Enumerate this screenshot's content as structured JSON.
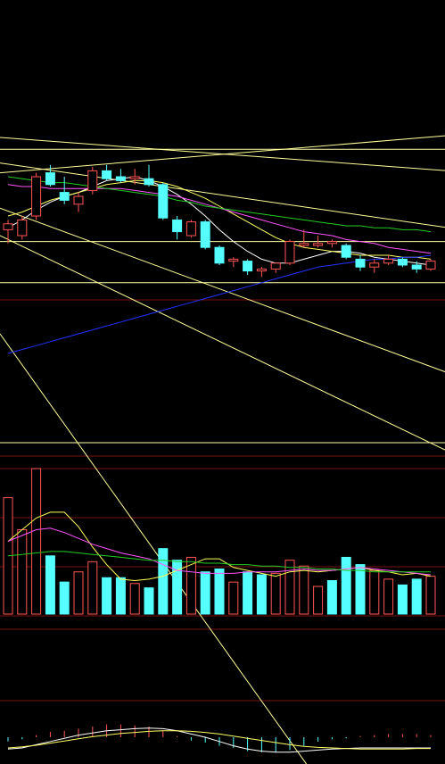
{
  "colors": {
    "background": "#000000",
    "up": "#ff5555",
    "down": "#55ffff",
    "grid": "#7a1010",
    "ma5": "#ffffff",
    "ma10": "#ffff66",
    "ma20": "#ff55ff",
    "ma30": "#22cc22",
    "ma60": "#2233ff",
    "trendline": "#ffff99",
    "hline": "#ffffaa",
    "vol_ma5": "#ffff55",
    "vol_ma10": "#ff55ff",
    "vol_ma20": "#22cc22"
  },
  "chart_data": [
    {
      "type": "candlestick",
      "panel": "price",
      "title": "",
      "ylim": [
        0,
        100
      ],
      "grid": true,
      "candles": [
        {
          "o": 33,
          "h": 38,
          "l": 26,
          "c": 36
        },
        {
          "o": 30,
          "h": 40,
          "l": 28,
          "c": 38
        },
        {
          "o": 40,
          "h": 62,
          "l": 38,
          "c": 60
        },
        {
          "o": 62,
          "h": 66,
          "l": 55,
          "c": 56
        },
        {
          "o": 52,
          "h": 60,
          "l": 46,
          "c": 48
        },
        {
          "o": 46,
          "h": 52,
          "l": 42,
          "c": 50
        },
        {
          "o": 53,
          "h": 65,
          "l": 51,
          "c": 63
        },
        {
          "o": 63,
          "h": 66,
          "l": 58,
          "c": 59
        },
        {
          "o": 60,
          "h": 64,
          "l": 57,
          "c": 58
        },
        {
          "o": 59,
          "h": 64,
          "l": 56,
          "c": 60
        },
        {
          "o": 59,
          "h": 66,
          "l": 55,
          "c": 56
        },
        {
          "o": 56,
          "h": 57,
          "l": 38,
          "c": 39
        },
        {
          "o": 38,
          "h": 40,
          "l": 28,
          "c": 32
        },
        {
          "o": 30,
          "h": 38,
          "l": 29,
          "c": 37
        },
        {
          "o": 37,
          "h": 38,
          "l": 23,
          "c": 24
        },
        {
          "o": 24,
          "h": 25,
          "l": 15,
          "c": 16
        },
        {
          "o": 17,
          "h": 19,
          "l": 14,
          "c": 18
        },
        {
          "o": 17,
          "h": 18,
          "l": 10,
          "c": 12
        },
        {
          "o": 12,
          "h": 14,
          "l": 9,
          "c": 13
        },
        {
          "o": 13,
          "h": 15,
          "l": 11,
          "c": 16
        },
        {
          "o": 16,
          "h": 28,
          "l": 15,
          "c": 27
        },
        {
          "o": 25,
          "h": 33,
          "l": 24,
          "c": 26
        },
        {
          "o": 25,
          "h": 30,
          "l": 24,
          "c": 26
        },
        {
          "o": 26,
          "h": 28,
          "l": 24,
          "c": 27
        },
        {
          "o": 25,
          "h": 26,
          "l": 18,
          "c": 19
        },
        {
          "o": 18,
          "h": 20,
          "l": 12,
          "c": 14
        },
        {
          "o": 14,
          "h": 18,
          "l": 11,
          "c": 16
        },
        {
          "o": 16,
          "h": 20,
          "l": 15,
          "c": 18
        },
        {
          "o": 18,
          "h": 19,
          "l": 14,
          "c": 15
        },
        {
          "o": 15,
          "h": 17,
          "l": 11,
          "c": 13
        },
        {
          "o": 13,
          "h": 18,
          "l": 12,
          "c": 17
        }
      ],
      "moving_averages": [
        {
          "name": "",
          "color_key": "ma5",
          "values": [
            34,
            38,
            43,
            47,
            50,
            52,
            55,
            58,
            59,
            60,
            58,
            55,
            51,
            46,
            40,
            33,
            27,
            22,
            18,
            16,
            16,
            18,
            20,
            22,
            22,
            21,
            19,
            18,
            17,
            16,
            15
          ]
        },
        {
          "name": "",
          "color_key": "ma10",
          "values": [
            40,
            42,
            45,
            48,
            50,
            52,
            54,
            56,
            57,
            58,
            58,
            57,
            55,
            52,
            49,
            45,
            41,
            37,
            33,
            29,
            26,
            24,
            23,
            22,
            21,
            20,
            20,
            20,
            19,
            19,
            18
          ]
        },
        {
          "name": "",
          "color_key": "ma20",
          "values": [
            56,
            55,
            55,
            54,
            54,
            54,
            54,
            54,
            54,
            53,
            52,
            51,
            50,
            48,
            46,
            44,
            42,
            40,
            38,
            36,
            34,
            32,
            31,
            30,
            28,
            27,
            26,
            24,
            23,
            22,
            21
          ]
        },
        {
          "name": "",
          "color_key": "ma30",
          "values": [
            60,
            59,
            58,
            57,
            57,
            56,
            55,
            54,
            53,
            52,
            51,
            50,
            48,
            47,
            45,
            44,
            43,
            42,
            41,
            40,
            39,
            38,
            37,
            36,
            35,
            35,
            34,
            34,
            33,
            33,
            32
          ]
        },
        {
          "name": "",
          "color_key": "ma60",
          "values": [
            -30,
            -28,
            -26,
            -24,
            -22,
            -20,
            -18,
            -16,
            -14,
            -12,
            -10,
            -8,
            -6,
            -4,
            -2,
            0,
            2,
            4,
            6,
            8,
            10,
            12,
            14,
            15,
            16,
            17,
            18,
            18,
            19,
            19,
            20
          ]
        }
      ],
      "horizontal_lines": [
        74,
        27,
        6
      ],
      "trendlines": [
        {
          "from": [
            0,
            80
          ],
          "to": [
            30,
            63
          ]
        },
        {
          "from": [
            0,
            67
          ],
          "to": [
            30,
            34
          ]
        },
        {
          "from": [
            0,
            44
          ],
          "to": [
            30,
            -40
          ]
        },
        {
          "from": [
            0,
            30
          ],
          "to": [
            30,
            -80
          ]
        },
        {
          "from": [
            0,
            -20
          ],
          "to": [
            20,
            -240
          ]
        },
        {
          "from": [
            0,
            62
          ],
          "to": [
            30,
            81
          ]
        }
      ]
    },
    {
      "type": "bar",
      "panel": "volume",
      "title": "",
      "ylim": [
        0,
        100
      ],
      "grid": true,
      "bars": [
        {
          "v": 80,
          "up": true
        },
        {
          "v": 58,
          "up": true
        },
        {
          "v": 100,
          "up": true
        },
        {
          "v": 40,
          "up": false
        },
        {
          "v": 22,
          "up": false
        },
        {
          "v": 29,
          "up": true
        },
        {
          "v": 36,
          "up": true
        },
        {
          "v": 25,
          "up": false
        },
        {
          "v": 25,
          "up": false
        },
        {
          "v": 21,
          "up": true
        },
        {
          "v": 18,
          "up": false
        },
        {
          "v": 45,
          "up": false
        },
        {
          "v": 37,
          "up": false
        },
        {
          "v": 39,
          "up": true
        },
        {
          "v": 29,
          "up": false
        },
        {
          "v": 31,
          "up": false
        },
        {
          "v": 22,
          "up": true
        },
        {
          "v": 29,
          "up": false
        },
        {
          "v": 27,
          "up": false
        },
        {
          "v": 28,
          "up": true
        },
        {
          "v": 37,
          "up": true
        },
        {
          "v": 33,
          "up": true
        },
        {
          "v": 19,
          "up": true
        },
        {
          "v": 23,
          "up": false
        },
        {
          "v": 39,
          "up": false
        },
        {
          "v": 34,
          "up": false
        },
        {
          "v": 30,
          "up": true
        },
        {
          "v": 24,
          "up": true
        },
        {
          "v": 20,
          "up": false
        },
        {
          "v": 24,
          "up": false
        },
        {
          "v": 26,
          "up": true
        }
      ],
      "moving_averages": [
        {
          "name": "",
          "color_key": "vol_ma5",
          "values": [
            50,
            58,
            66,
            70,
            70,
            60,
            46,
            34,
            24,
            23,
            24,
            26,
            30,
            34,
            38,
            38,
            32,
            30,
            28,
            26,
            29,
            30,
            29,
            30,
            31,
            32,
            30,
            29,
            27,
            28,
            26
          ]
        },
        {
          "name": "",
          "color_key": "vol_ma10",
          "values": [
            50,
            54,
            58,
            59,
            56,
            52,
            48,
            45,
            42,
            40,
            38,
            34,
            30,
            29,
            28,
            28,
            28,
            29,
            29,
            29,
            30,
            31,
            30,
            30,
            31,
            32,
            31,
            30,
            29,
            28,
            27
          ]
        },
        {
          "name": "",
          "color_key": "vol_ma20",
          "values": [
            40,
            41,
            42,
            43,
            43,
            42,
            41,
            40,
            39,
            38,
            37,
            37,
            36,
            36,
            35,
            35,
            34,
            34,
            33,
            33,
            32,
            32,
            31,
            31,
            30,
            30,
            29,
            29,
            29,
            29,
            29
          ]
        }
      ]
    },
    {
      "type": "bar",
      "panel": "macd",
      "title": "",
      "ylim": [
        -40,
        60
      ],
      "grid": false,
      "histogram": [
        -8,
        -4,
        4,
        10,
        12,
        16,
        20,
        24,
        24,
        22,
        20,
        12,
        2,
        -6,
        -10,
        -16,
        -20,
        -26,
        -28,
        -28,
        -24,
        -16,
        -8,
        -4,
        -2,
        2,
        4,
        6,
        6,
        6,
        4
      ],
      "dif": [
        -22,
        -20,
        -14,
        -8,
        -2,
        4,
        8,
        12,
        14,
        16,
        17,
        16,
        12,
        6,
        0,
        -8,
        -16,
        -22,
        -26,
        -28,
        -28,
        -26,
        -24,
        -22,
        -21,
        -20,
        -20,
        -20,
        -20,
        -20,
        -20
      ],
      "dea": [
        -20,
        -18,
        -15,
        -11,
        -7,
        -3,
        1,
        4,
        7,
        9,
        11,
        12,
        12,
        11,
        9,
        6,
        2,
        -2,
        -6,
        -10,
        -14,
        -17,
        -19,
        -20,
        -21,
        -22,
        -22,
        -22,
        -22,
        -21,
        -21
      ]
    }
  ]
}
